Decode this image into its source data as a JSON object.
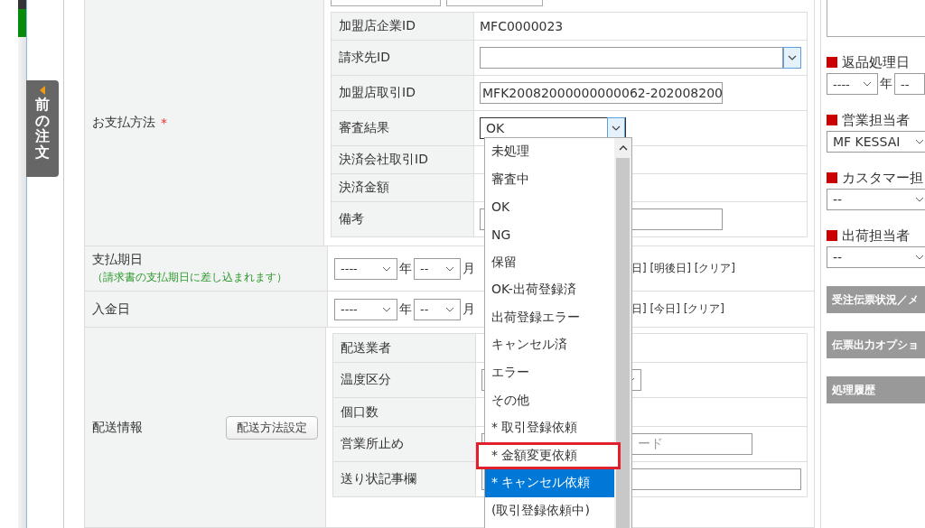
{
  "side_tab": {
    "label": "前の注文"
  },
  "top_fields": [
    {
      "kind": "input"
    },
    {
      "kind": "input"
    }
  ],
  "payment": {
    "label": "お支払方法",
    "required_mark": "*",
    "rows": [
      {
        "label": "加盟店企業ID",
        "kind": "text",
        "value": "MFC0000023"
      },
      {
        "label": "請求先ID",
        "kind": "lookup"
      },
      {
        "label": "加盟店取引ID",
        "kind": "input",
        "value": "MFK20082000000000062-202008200"
      },
      {
        "label": "審査結果",
        "kind": "select",
        "value": "OK",
        "open": true
      },
      {
        "label": "決済会社取引ID",
        "kind": "text"
      },
      {
        "label": "決済金額",
        "kind": "text"
      },
      {
        "label": "備考",
        "kind": "input"
      }
    ]
  },
  "due_date": {
    "label": "支払期日",
    "note": "（請求書の支払期日に差し込まれます）",
    "year": "----",
    "year_unit": "年",
    "month": "--",
    "month_unit": "月",
    "links": "日] [明後日] [クリア]"
  },
  "deposit_date": {
    "label": "入金日",
    "year": "----",
    "year_unit": "年",
    "month": "--",
    "month_unit": "月",
    "links": "日] [今日] [クリア]"
  },
  "delivery": {
    "label": "配送情報",
    "button": "配送方法設定",
    "rows": [
      {
        "label": "配送業者",
        "kind": "text"
      },
      {
        "label": "温度区分",
        "kind": "select"
      },
      {
        "label": "個口数",
        "kind": "text"
      },
      {
        "label": "営業所止め",
        "kind": "input",
        "placeholder": "ード"
      },
      {
        "label": "送り状記事欄",
        "kind": "input"
      }
    ]
  },
  "status_dropdown": {
    "options": [
      {
        "label": "未処理",
        "selected": false,
        "outlined": false
      },
      {
        "label": "審査中",
        "selected": false,
        "outlined": false
      },
      {
        "label": "OK",
        "selected": false,
        "outlined": false
      },
      {
        "label": "NG",
        "selected": false,
        "outlined": false
      },
      {
        "label": "保留",
        "selected": false,
        "outlined": false
      },
      {
        "label": "OK-出荷登録済",
        "selected": false,
        "outlined": false
      },
      {
        "label": "出荷登録エラー",
        "selected": false,
        "outlined": false
      },
      {
        "label": "キャンセル済",
        "selected": false,
        "outlined": false
      },
      {
        "label": "エラー",
        "selected": false,
        "outlined": false
      },
      {
        "label": "その他",
        "selected": false,
        "outlined": false
      },
      {
        "label": "* 取引登録依頼",
        "selected": false,
        "outlined": false
      },
      {
        "label": "* 金額変更依頼",
        "selected": false,
        "outlined": true
      },
      {
        "label": "* キャンセル依頼",
        "selected": true,
        "outlined": false
      },
      {
        "label": "(取引登録依頼中)",
        "selected": false,
        "outlined": false
      }
    ]
  },
  "right_panel": {
    "fields": [
      {
        "label": "返品処理日",
        "kind": "date",
        "year": "----",
        "year_unit": "年",
        "month": "--"
      },
      {
        "label": "営業担当者",
        "kind": "select",
        "value": "MF KESSAI"
      },
      {
        "label": "カスタマー担",
        "kind": "select",
        "value": "--"
      },
      {
        "label": "出荷担当者",
        "kind": "select",
        "value": "--"
      }
    ],
    "sections": [
      "受注伝票状況／メ",
      "伝票出力オプショ",
      "処理履歴"
    ]
  }
}
